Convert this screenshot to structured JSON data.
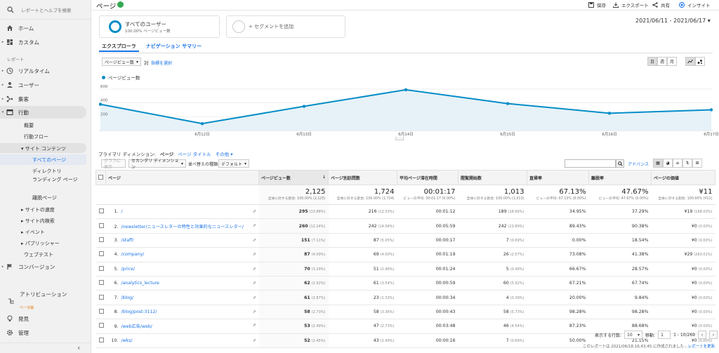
{
  "sidebar": {
    "search_placeholder": "レポートとヘルプを検索",
    "home": "ホーム",
    "custom": "カスタム",
    "report_section": "レポート",
    "realtime": "リアルタイム",
    "users": "ユーザー",
    "acquisition": "集客",
    "behavior": "行動",
    "overview": "概要",
    "behavior_flow": "行動フロー",
    "site_content": "サイト コンテンツ",
    "all_pages": "すべてのページ",
    "directory": "ディレクトリ",
    "landing_page": "ランディング ページ",
    "exit_page": "離脱ページ",
    "site_speed": "サイトの速度",
    "site_search": "サイト内検索",
    "events": "イベント",
    "publisher": "パブリッシャー",
    "web_test": "ウェブテスト",
    "conversions": "コンバージョン",
    "attribution": "アトリビューション",
    "attribution_badge": "ベータ版",
    "discover": "発見",
    "admin": "管理",
    "collapse": "‹"
  },
  "topbar": {
    "title": "ページ",
    "save": "保存",
    "export": "エクスポート",
    "share": "共有",
    "insight": "インサイト"
  },
  "segments": {
    "all_users": "すべてのユーザー",
    "all_users_sub": "100.00% ページビュー数",
    "add_segment": "+ セグメントを追加"
  },
  "date_range": "2021/06/11 - 2021/06/17",
  "tabs": [
    "エクスプローラ",
    "ナビゲーション サマリー"
  ],
  "chart_controls": {
    "metric_select": "ページビュー数",
    "vs": "対",
    "select_metric": "指標を選択",
    "period_buttons": [
      "日",
      "週",
      "月"
    ]
  },
  "chart_data": {
    "type": "line",
    "series": [
      {
        "name": "ページビュー数",
        "values": [
          380,
          100,
          350,
          590,
          390,
          250,
          300
        ]
      }
    ],
    "x_labels": [
      "",
      "6月12日",
      "6月13日",
      "6月14日",
      "6月15日",
      "6月16日",
      "6月17日"
    ],
    "y_ticks": [
      "600",
      "400",
      "200"
    ],
    "ylim": [
      0,
      650
    ],
    "color": "#058dc7"
  },
  "dimension_row": {
    "label": "プライマリ ディメンション:",
    "page": "ページ",
    "page_title": "ページ タイトル",
    "other": "その他",
    "plot_rows": "グラフに表示",
    "secondary": "セカンダリ ディメンション",
    "sort_type": "並べ替えの種類:",
    "default": "デフォルト",
    "advanced": "アドバンス"
  },
  "table": {
    "headers": [
      "ページ",
      "ページビュー数",
      "ページ別訪問数",
      "平均ページ滞在時間",
      "閲覧開始数",
      "直帰率",
      "離脱率",
      "ページの価値"
    ],
    "totals": [
      {
        "v": "2,125",
        "s": "全体に対する割合: 100.00% (2,125)"
      },
      {
        "v": "1,724",
        "s": "全体に対する割合: 100.00% (1,724)"
      },
      {
        "v": "00:01:17",
        "s": "ビューの平均: 00:01:17 (0.00%)"
      },
      {
        "v": "1,013",
        "s": "全体に対する割合: 100.00% (1,013)"
      },
      {
        "v": "67.13%",
        "s": "ビューの平均: 67.13% (0.00%)"
      },
      {
        "v": "47.67%",
        "s": "ビューの平均: 47.67% (0.00%)"
      },
      {
        "v": "¥11",
        "s": "全体に対する割合: 100.00% (¥11)"
      }
    ],
    "rows": [
      [
        "1.",
        "/",
        "295",
        "(13.88%)",
        "216",
        "(12.53%)",
        "00:01:12",
        "189",
        "(18.66%)",
        "34.95%",
        "37.29%",
        "¥19",
        "(168.03%)"
      ],
      [
        "2.",
        "/newsletter/ニュースレターの特性と効果的なニュースレター/",
        "260",
        "(12.24%)",
        "242",
        "(14.04%)",
        "00:05:59",
        "242",
        "(23.89%)",
        "89.43%",
        "90.38%",
        "¥0",
        "(0.00%)"
      ],
      [
        "3.",
        "/staff/",
        "151",
        "(7.11%)",
        "87",
        "(5.05%)",
        "00:00:17",
        "7",
        "(0.69%)",
        "0.00%",
        "18.54%",
        "¥0",
        "(0.00%)"
      ],
      [
        "4.",
        "/company/",
        "87",
        "(4.09%)",
        "69",
        "(4.00%)",
        "00:01:19",
        "26",
        "(2.57%)",
        "73.08%",
        "41.38%",
        "¥29",
        "(263.01%)"
      ],
      [
        "5.",
        "/price/",
        "70",
        "(3.29%)",
        "51",
        "(2.96%)",
        "00:01:24",
        "5",
        "(0.49%)",
        "66.67%",
        "28.57%",
        "¥0",
        "(0.00%)"
      ],
      [
        "6.",
        "/analytics_lecture",
        "62",
        "(2.92%)",
        "61",
        "(3.54%)",
        "00:00:59",
        "60",
        "(5.92%)",
        "67.21%",
        "67.74%",
        "¥0",
        "(0.00%)"
      ],
      [
        "7.",
        "/blog/",
        "61",
        "(2.87%)",
        "23",
        "(1.33%)",
        "00:00:34",
        "4",
        "(0.39%)",
        "20.00%",
        "9.84%",
        "¥0",
        "(0.00%)"
      ],
      [
        "8.",
        "/blog/post-3112/",
        "58",
        "(2.73%)",
        "58",
        "(3.36%)",
        "00:00:43",
        "58",
        "(5.73%)",
        "98.28%",
        "98.28%",
        "¥0",
        "(0.00%)"
      ],
      [
        "9.",
        "/web広告/web/",
        "53",
        "(2.49%)",
        "47",
        "(2.73%)",
        "00:03:48",
        "46",
        "(4.54%)",
        "87.23%",
        "88.68%",
        "¥0",
        "(0.00%)"
      ],
      [
        "10.",
        "/wks/",
        "52",
        "(2.45%)",
        "43",
        "(2.49%)",
        "00:00:16",
        "7",
        "(0.69%)",
        "50.00%",
        "21.15%",
        "¥0",
        "(0.00%)"
      ]
    ]
  },
  "pagination": {
    "rows_label": "表示する行数:",
    "rows_value": "10",
    "goto_label": "移動:",
    "goto_value": "1",
    "range": "1 - 10/269",
    "prev": "‹",
    "next": "›"
  },
  "footer": {
    "created": "このレポートは 2021/06/18 16:43:45 に作成されました -",
    "refresh": "レポートを更新"
  }
}
